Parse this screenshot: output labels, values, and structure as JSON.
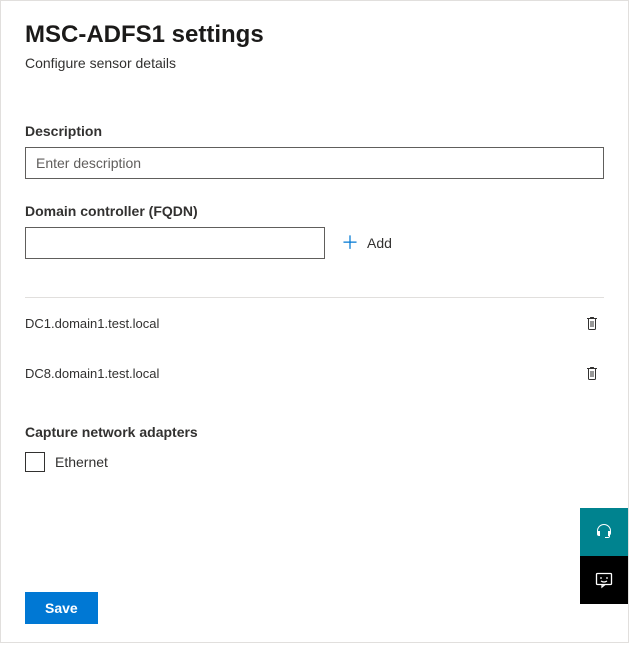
{
  "header": {
    "title": "MSC-ADFS1 settings",
    "subtitle": "Configure sensor details"
  },
  "description": {
    "label": "Description",
    "placeholder": "Enter description",
    "value": ""
  },
  "fqdn": {
    "label": "Domain controller (FQDN)",
    "value": "",
    "add_label": "Add"
  },
  "domain_controllers": [
    {
      "name": "DC1.domain1.test.local"
    },
    {
      "name": "DC8.domain1.test.local"
    }
  ],
  "capture": {
    "label": "Capture network adapters",
    "adapters": [
      {
        "name": "Ethernet",
        "checked": false
      }
    ]
  },
  "actions": {
    "save_label": "Save"
  }
}
